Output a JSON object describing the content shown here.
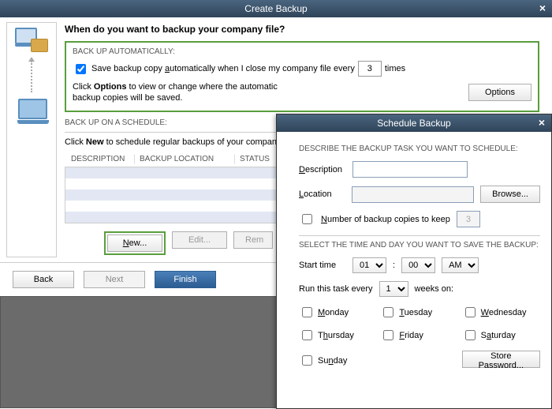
{
  "window1": {
    "title": "Create Backup",
    "heading": "When do you want to backup your company file?",
    "auto": {
      "label": "BACK UP AUTOMATICALLY:",
      "checkbox_text": "Save backup copy automatically when I close my company file every",
      "times_value": "3",
      "times_suffix": "times",
      "options_text_prefix": "Click ",
      "options_bold": "Options",
      "options_text_suffix": " to view or change where the automatic backup copies will be saved.",
      "options_btn": "Options"
    },
    "schedule": {
      "label": "BACK UP ON A SCHEDULE:",
      "text_prefix": "Click ",
      "text_bold": "New",
      "text_suffix": " to schedule regular backups of your company file.",
      "cols": {
        "desc": "DESCRIPTION",
        "loc": "BACKUP LOCATION",
        "status": "STATUS"
      },
      "new_btn": "New...",
      "edit_btn": "Edit...",
      "remove_btn": "Rem"
    },
    "footer": {
      "back": "Back",
      "next": "Next",
      "finish": "Finish"
    }
  },
  "window2": {
    "title": "Schedule Backup",
    "describe_h": "DESCRIBE THE BACKUP TASK YOU WANT TO SCHEDULE:",
    "description_label": "Description",
    "location_label": "Location",
    "browse_btn": "Browse...",
    "numcopies_label": "Number of backup copies to keep",
    "numcopies_value": "3",
    "select_h": "SELECT THE TIME AND DAY YOU WANT TO SAVE THE BACKUP:",
    "start_label": "Start time",
    "hour": "01",
    "minute": "00",
    "ampm": "AM",
    "colon": ":",
    "run_prefix": "Run this task every",
    "weeks_val": "1",
    "run_suffix": "weeks on:",
    "days": {
      "mon": "Monday",
      "tue": "Tuesday",
      "wed": "Wednesday",
      "thu": "Thursday",
      "fri": "Friday",
      "sat": "Saturday",
      "sun": "Sunday"
    },
    "store_pw": "Store Password..."
  }
}
